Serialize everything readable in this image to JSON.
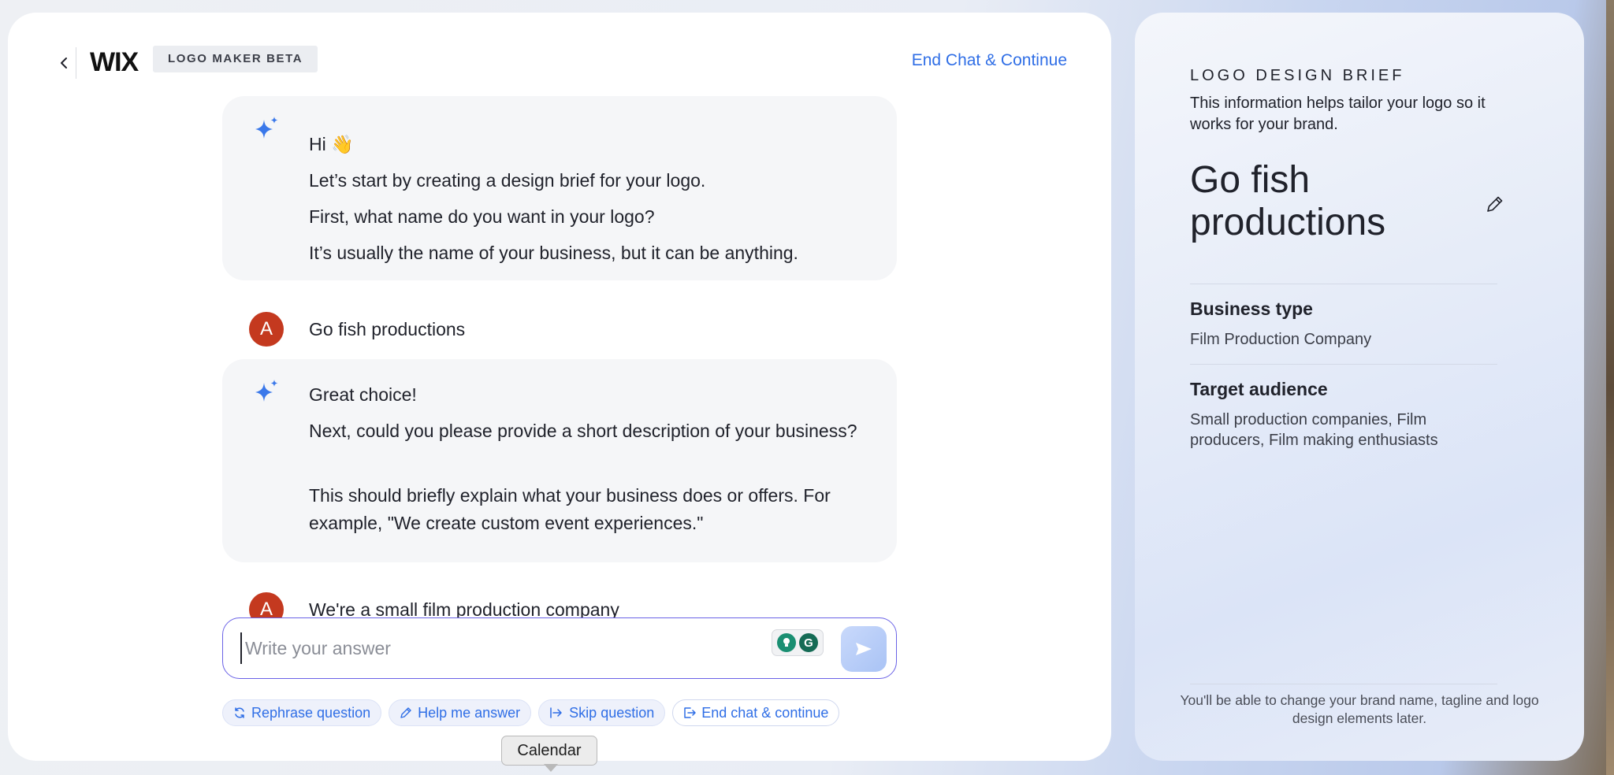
{
  "header": {
    "brand_logo": "WIX",
    "product_badge": "LOGO MAKER BETA",
    "end_chat_label": "End Chat & Continue"
  },
  "conversation": [
    {
      "role": "assistant",
      "greeting": "Hi 👋",
      "intro": "Let’s start by creating a design brief for your logo.",
      "question": "First, what name do you want in your logo?",
      "hint": "It’s usually the name of your business, but it can be anything."
    },
    {
      "role": "user",
      "avatar_initial": "A",
      "text": "Go fish productions"
    },
    {
      "role": "assistant",
      "greeting": "Great choice!",
      "question": "Next, could you please provide a short description of your business?",
      "hint": "This should briefly explain what your business does or offers. For example, \"We create custom event experiences.\""
    },
    {
      "role": "user",
      "avatar_initial": "A",
      "text": "We're a small film production company"
    }
  ],
  "composer": {
    "placeholder": "Write your answer",
    "send_icon": "send-arrow-icon"
  },
  "quick_actions": [
    {
      "label": "Rephrase question",
      "icon": "rephrase-icon"
    },
    {
      "label": "Help me answer",
      "icon": "pencil-icon"
    },
    {
      "label": "Skip question",
      "icon": "skip-icon"
    },
    {
      "label": "End chat & continue",
      "icon": "exit-icon"
    }
  ],
  "tooltip": {
    "text": "Calendar"
  },
  "brief": {
    "eyebrow": "LOGO DESIGN BRIEF",
    "description": "This information helps tailor your logo so it works for your brand.",
    "brand_name": "Go fish productions",
    "fields": [
      {
        "label": "Business type",
        "value": "Film Production Company"
      },
      {
        "label": "Target audience",
        "value": "Small production companies, Film producers, Film making enthusiasts"
      }
    ],
    "footnote": "You'll be able to change your brand name, tagline and logo design elements later."
  },
  "colors": {
    "accent": "#2f6ee6",
    "avatar": "#c4391f",
    "input_focus": "#6a62e6",
    "card_bg": "#f5f6f8"
  }
}
